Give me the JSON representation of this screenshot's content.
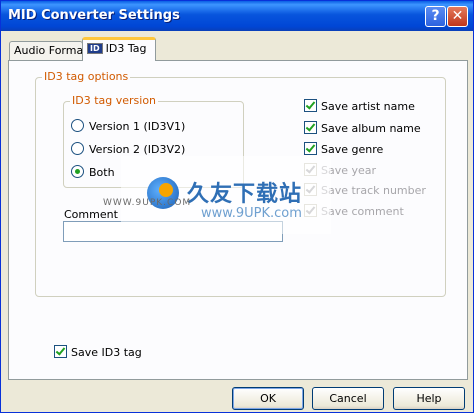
{
  "window": {
    "title": "MID Converter Settings",
    "help_glyph": "?",
    "close_glyph": "✕"
  },
  "tabs": [
    {
      "label": "Audio Format",
      "selected": false
    },
    {
      "label": "ID3 Tag",
      "badge": "ID",
      "selected": true
    }
  ],
  "id3_options": {
    "group_label": "ID3 tag options",
    "version_group": {
      "label": "ID3 tag version",
      "options": [
        {
          "label": "Version 1 (ID3V1)",
          "selected": false
        },
        {
          "label": "Version 2 (ID3V2)",
          "selected": false
        },
        {
          "label": "Both",
          "selected": true
        }
      ]
    },
    "checkboxes": [
      {
        "label": "Save artist name",
        "checked": true,
        "enabled": true
      },
      {
        "label": "Save album name",
        "checked": true,
        "enabled": true
      },
      {
        "label": "Save genre",
        "checked": true,
        "enabled": true
      },
      {
        "label": "Save year",
        "checked": true,
        "enabled": false
      },
      {
        "label": "Save track number",
        "checked": true,
        "enabled": false
      },
      {
        "label": "Save comment",
        "checked": true,
        "enabled": false
      }
    ],
    "comment_label": "Comment",
    "comment_value": ""
  },
  "save_id3_tag": {
    "label": "Save ID3 tag",
    "checked": true
  },
  "buttons": {
    "ok": "OK",
    "cancel": "Cancel",
    "help": "Help"
  },
  "watermark": {
    "cn": "久友下载站",
    "url": "www.9UPK.com",
    "small": "WWW.9UPK.COM"
  }
}
